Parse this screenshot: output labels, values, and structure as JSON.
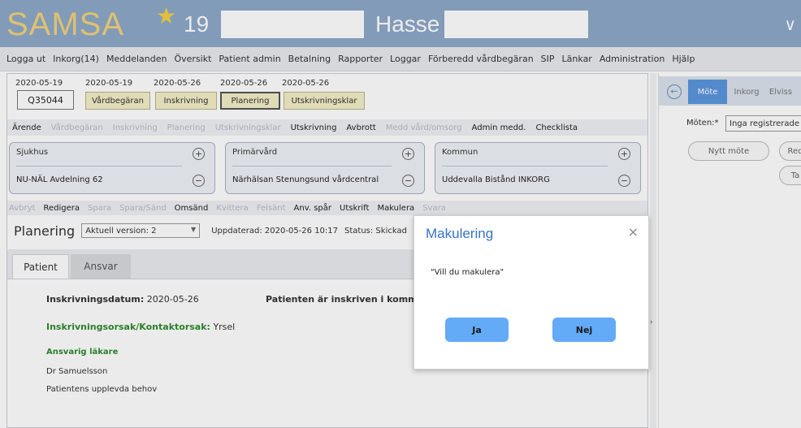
{
  "header": {
    "brand": "SAMSA",
    "notification_count": "19",
    "user_name": "Hasse"
  },
  "menu": [
    "Logga ut",
    "Inkorg(14)",
    "Meddelanden",
    "Översikt",
    "Patient admin",
    "Betalning",
    "Rapporter",
    "Loggar",
    "Förberedd vårdbegäran",
    "SIP",
    "Länkar",
    "Administration",
    "Hjälp"
  ],
  "case": {
    "id": "Q35044",
    "dates": [
      "2020-05-19",
      "2020-05-19",
      "2020-05-26",
      "2020-05-26",
      "2020-05-26"
    ],
    "stages": [
      "Vårdbegäran",
      "Inskrivning",
      "Planering",
      "Utskrivningsklar"
    ]
  },
  "arende_bar": [
    {
      "label": "Ärende",
      "enabled": true
    },
    {
      "label": "Vårdbegäran",
      "enabled": false
    },
    {
      "label": "Inskrivning",
      "enabled": false
    },
    {
      "label": "Planering",
      "enabled": false
    },
    {
      "label": "Utskrivningsklar",
      "enabled": false
    },
    {
      "label": "Utskrivning",
      "enabled": true
    },
    {
      "label": "Avbrott",
      "enabled": true
    },
    {
      "label": "Medd vård/omsorg",
      "enabled": false
    },
    {
      "label": "Admin medd.",
      "enabled": true
    },
    {
      "label": "Checklista",
      "enabled": true
    }
  ],
  "care_units": [
    {
      "title": "Sjukhus",
      "name": "NU-NÄL Avdelning 62"
    },
    {
      "title": "Primärvård",
      "name": "Närhälsan Stenungsund vårdcentral"
    },
    {
      "title": "Kommun",
      "name": "Uddevalla Bistånd INKORG"
    }
  ],
  "actions": [
    {
      "label": "Avbryt",
      "enabled": false
    },
    {
      "label": "Redigera",
      "enabled": true
    },
    {
      "label": "Spara",
      "enabled": false
    },
    {
      "label": "Spara/Sänd",
      "enabled": false
    },
    {
      "label": "Omsänd",
      "enabled": true
    },
    {
      "label": "Kvittera",
      "enabled": false
    },
    {
      "label": "Felsänt",
      "enabled": false
    },
    {
      "label": "Anv. spår",
      "enabled": true
    },
    {
      "label": "Utskrift",
      "enabled": true
    },
    {
      "label": "Makulera",
      "enabled": true
    },
    {
      "label": "Svara",
      "enabled": false
    }
  ],
  "plan": {
    "title": "Planering",
    "version": "Aktuell version: 2",
    "updated": "Uppdaterad: 2020-05-26 10:17",
    "status": "Status: Skickad"
  },
  "tabs": [
    "Patient",
    "Ansvar"
  ],
  "patient": {
    "inskrivningsdatum_label": "Inskrivningsdatum:",
    "inskrivningsdatum_value": "2020-05-26",
    "patient_note": "Patienten är inskriven i komm",
    "orsak_label": "Inskrivningsorsak/Kontaktorsak:",
    "orsak_value": "Yrsel",
    "ansvarig_label": "Ansvarig läkare",
    "ansvarig_value": "Dr Samuelsson",
    "behov_label": "Patientens upplevda behov"
  },
  "right_panel": {
    "tabs": [
      "Möte",
      "Inkorg",
      "Elviss"
    ],
    "meeting_label": "Möten:*",
    "meeting_value": "Inga registrerade",
    "new_meeting": "Nytt möte",
    "btn_red": "Red",
    "btn_ta": "Ta"
  },
  "modal": {
    "title": "Makulering",
    "message": "\"Vill du makulera\"",
    "yes": "Ja",
    "no": "Nej",
    "close": "×"
  }
}
